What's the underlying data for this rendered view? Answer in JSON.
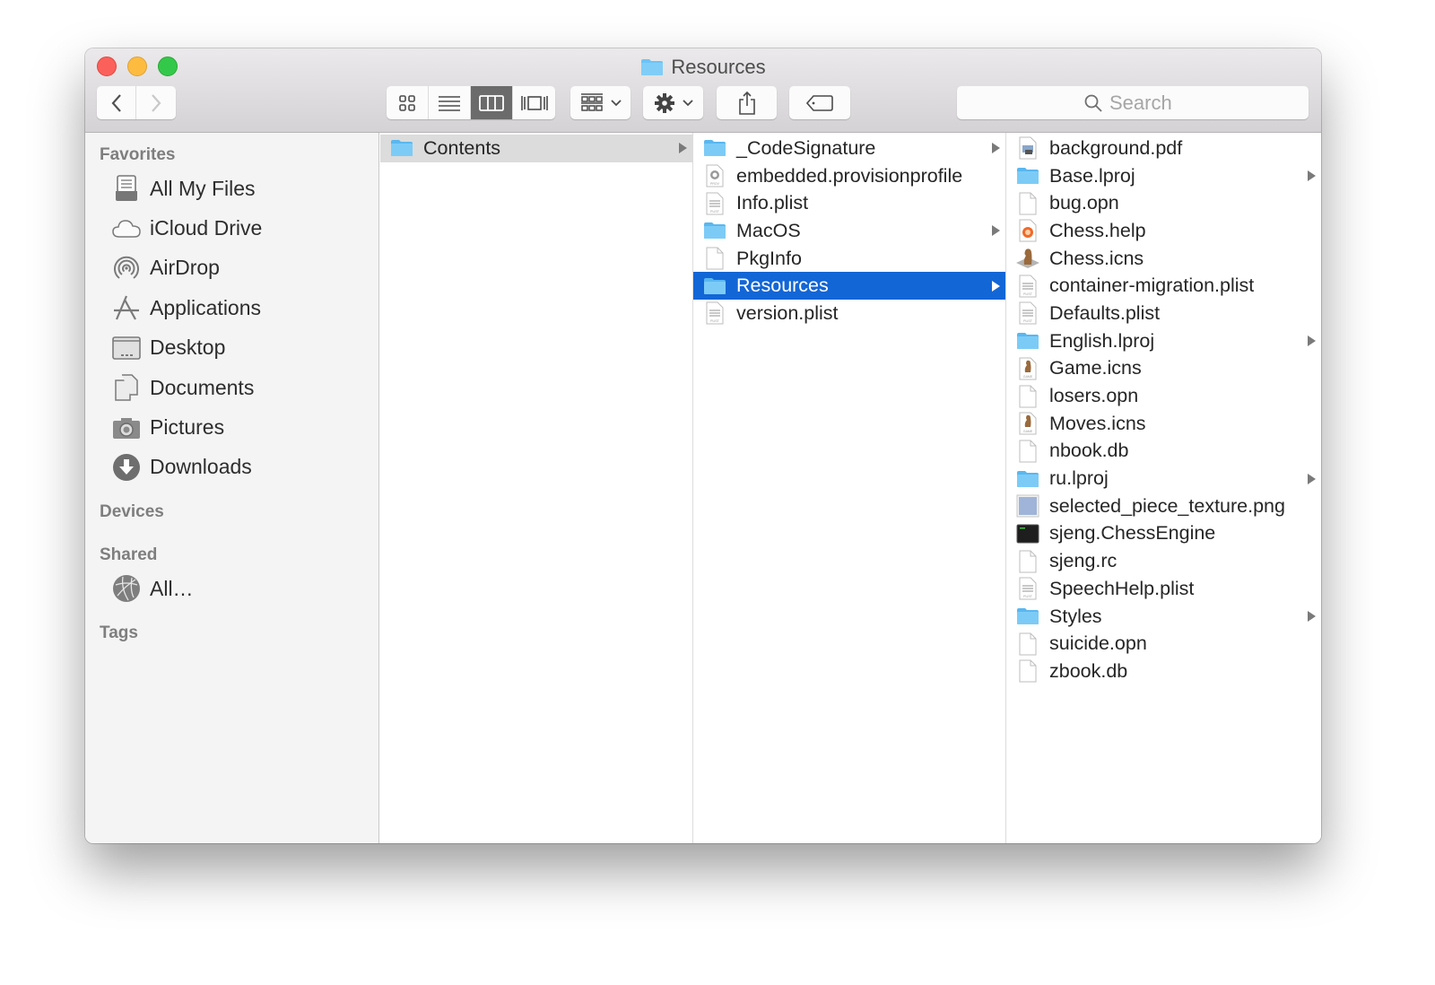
{
  "window": {
    "title": "Resources"
  },
  "toolbar": {
    "back_label": "Back",
    "forward_label": "Forward",
    "view_modes": [
      "icon-view",
      "list-view",
      "column-view",
      "cover-flow-view"
    ],
    "active_view": "column-view",
    "arrange_label": "Arrange",
    "action_label": "Action",
    "share_label": "Share",
    "tags_label": "Edit Tags",
    "search_placeholder": "Search"
  },
  "sidebar": {
    "favorites_label": "Favorites",
    "favorites": [
      {
        "label": "All My Files",
        "icon": "all-files-icon"
      },
      {
        "label": "iCloud Drive",
        "icon": "cloud-icon"
      },
      {
        "label": "AirDrop",
        "icon": "airdrop-icon"
      },
      {
        "label": "Applications",
        "icon": "applications-icon"
      },
      {
        "label": "Desktop",
        "icon": "desktop-icon"
      },
      {
        "label": "Documents",
        "icon": "documents-icon"
      },
      {
        "label": "Pictures",
        "icon": "camera-icon"
      },
      {
        "label": "Downloads",
        "icon": "download-icon"
      }
    ],
    "devices_label": "Devices",
    "shared_label": "Shared",
    "shared": [
      {
        "label": "All…",
        "icon": "network-globe-icon"
      }
    ],
    "tags_label": "Tags"
  },
  "columns": [
    {
      "items": [
        {
          "name": "Contents",
          "type": "folder",
          "expandable": true,
          "state": "parent"
        }
      ]
    },
    {
      "items": [
        {
          "name": "_CodeSignature",
          "type": "folder",
          "expandable": true
        },
        {
          "name": "embedded.provisionprofile",
          "type": "provision"
        },
        {
          "name": "Info.plist",
          "type": "plist"
        },
        {
          "name": "MacOS",
          "type": "folder",
          "expandable": true
        },
        {
          "name": "PkgInfo",
          "type": "file"
        },
        {
          "name": "Resources",
          "type": "folder",
          "expandable": true,
          "state": "selected"
        },
        {
          "name": "version.plist",
          "type": "plist"
        }
      ]
    },
    {
      "items": [
        {
          "name": "background.pdf",
          "type": "pdf"
        },
        {
          "name": "Base.lproj",
          "type": "folder",
          "expandable": true
        },
        {
          "name": "bug.opn",
          "type": "file"
        },
        {
          "name": "Chess.help",
          "type": "help"
        },
        {
          "name": "Chess.icns",
          "type": "chess"
        },
        {
          "name": "container-migration.plist",
          "type": "plist"
        },
        {
          "name": "Defaults.plist",
          "type": "plist"
        },
        {
          "name": "English.lproj",
          "type": "folder",
          "expandable": true
        },
        {
          "name": "Game.icns",
          "type": "game-icns"
        },
        {
          "name": "losers.opn",
          "type": "file"
        },
        {
          "name": "Moves.icns",
          "type": "game-icns"
        },
        {
          "name": "nbook.db",
          "type": "file"
        },
        {
          "name": "ru.lproj",
          "type": "folder",
          "expandable": true
        },
        {
          "name": "selected_piece_texture.png",
          "type": "image"
        },
        {
          "name": "sjeng.ChessEngine",
          "type": "exec"
        },
        {
          "name": "sjeng.rc",
          "type": "file"
        },
        {
          "name": "SpeechHelp.plist",
          "type": "plist"
        },
        {
          "name": "Styles",
          "type": "folder",
          "expandable": true
        },
        {
          "name": "suicide.opn",
          "type": "file"
        },
        {
          "name": "zbook.db",
          "type": "file"
        }
      ]
    }
  ],
  "colors": {
    "selection": "#1366d6",
    "folder": "#6cc3f5",
    "parent_highlight": "#dcdcdc"
  }
}
